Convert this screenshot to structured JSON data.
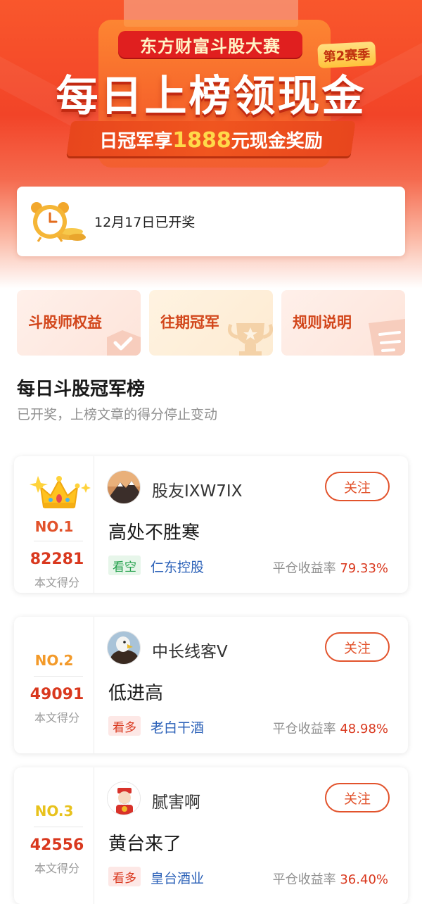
{
  "banner": {
    "contest_name": "东方财富斗股大赛",
    "season": "第2赛季",
    "headline": "每日上榜领现金",
    "prize_prefix": "日冠军享",
    "prize_amount": "1888",
    "prize_suffix": "元现金奖励"
  },
  "status": {
    "icon": "alarm-clock-icon",
    "text": "12月17日已开奖"
  },
  "entries": [
    {
      "label": "斗股师权益",
      "icon": "check-badge-icon"
    },
    {
      "label": "往期冠军",
      "icon": "trophy-icon"
    },
    {
      "label": "规则说明",
      "icon": "document-icon"
    }
  ],
  "section": {
    "title": "每日斗股冠军榜",
    "subtitle": "已开奖，上榜文章的得分停止变动"
  },
  "score_label": "本文得分",
  "follow_label": "关注",
  "yield_label": "平仓收益率",
  "rankings": [
    {
      "rank": "NO.1",
      "rank_color": "#e2532c",
      "score": "82281",
      "user": "股友IXW7IX",
      "title": "高处不胜寒",
      "view": "看空",
      "view_type": "bear",
      "stock": "仁东控股",
      "yield": "79.33%"
    },
    {
      "rank": "NO.2",
      "rank_color": "#f39a2a",
      "score": "49091",
      "user": "中长线客V",
      "title": "低进高",
      "view": "看多",
      "view_type": "bull",
      "stock": "老白干酒",
      "yield": "48.98%"
    },
    {
      "rank": "NO.3",
      "rank_color": "#e8c21d",
      "score": "42556",
      "user": "腻害啊",
      "title": "黄台来了",
      "view": "看多",
      "view_type": "bull",
      "stock": "皇台酒业",
      "yield": "36.40%"
    }
  ],
  "colors": {
    "accent": "#e2532c",
    "banner_red": "#f24428",
    "gain_red": "#d9381e",
    "bear_green": "#21a04a",
    "stock_blue": "#2b61b8"
  }
}
